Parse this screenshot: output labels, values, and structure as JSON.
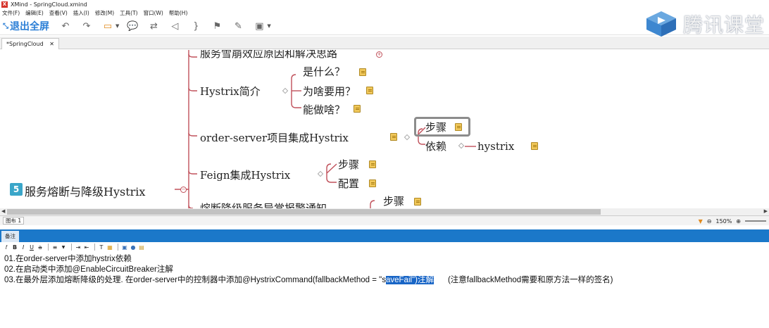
{
  "window": {
    "title": "XMind - SpringCloud.xmind",
    "logo": "X"
  },
  "menu": [
    "文件(F)",
    "编辑(E)",
    "查看(V)",
    "插入(I)",
    "修改(M)",
    "工具(T)",
    "窗口(W)",
    "帮助(H)"
  ],
  "toolbar": {
    "exit_fullscreen": "退出全屏"
  },
  "watermark": {
    "text": "腾讯课堂"
  },
  "editor_tab": "*SpringCloud",
  "mindmap": {
    "partial_top": "服务雪崩效应原因和解决思路",
    "root": {
      "badge": "5",
      "label": "服务熔断与降级Hystrix"
    },
    "hystrix_intro": {
      "label": "Hystrix简介",
      "children": [
        "是什么？",
        "为啥要用？",
        "能做啥？"
      ]
    },
    "order_server": {
      "label": "order-server项目集成Hystrix",
      "children": [
        "步骤",
        "依赖"
      ],
      "dep_child": "hystrix"
    },
    "feign": {
      "label": "Feign集成Hystrix",
      "children": [
        "步骤",
        "配置"
      ]
    },
    "partial_bottom": {
      "label": "熔断降级服务异常报警通知",
      "child": "步骤"
    }
  },
  "sheetbar": {
    "tab": "图布 1",
    "zoom": "150%"
  },
  "notes": {
    "tab": "备注",
    "line1": "01.在order-server中添加hystrix依赖",
    "line2": "02.在启动类中添加@EnableCircuitBreaker注解",
    "line3_pre": "03.在最外层添加熔断降级的处理. 在order-server中的控制器中添加@HystrixCommand(fallbackMethod = \"s",
    "line3_hl": "aveFail\")注解",
    "line3_post": "(注意fallbackMethod需要和原方法一样的签名)"
  },
  "colors": {
    "accent": "#1b78c9",
    "branch": "#c0505a",
    "note_icon": "#f0c75a"
  }
}
